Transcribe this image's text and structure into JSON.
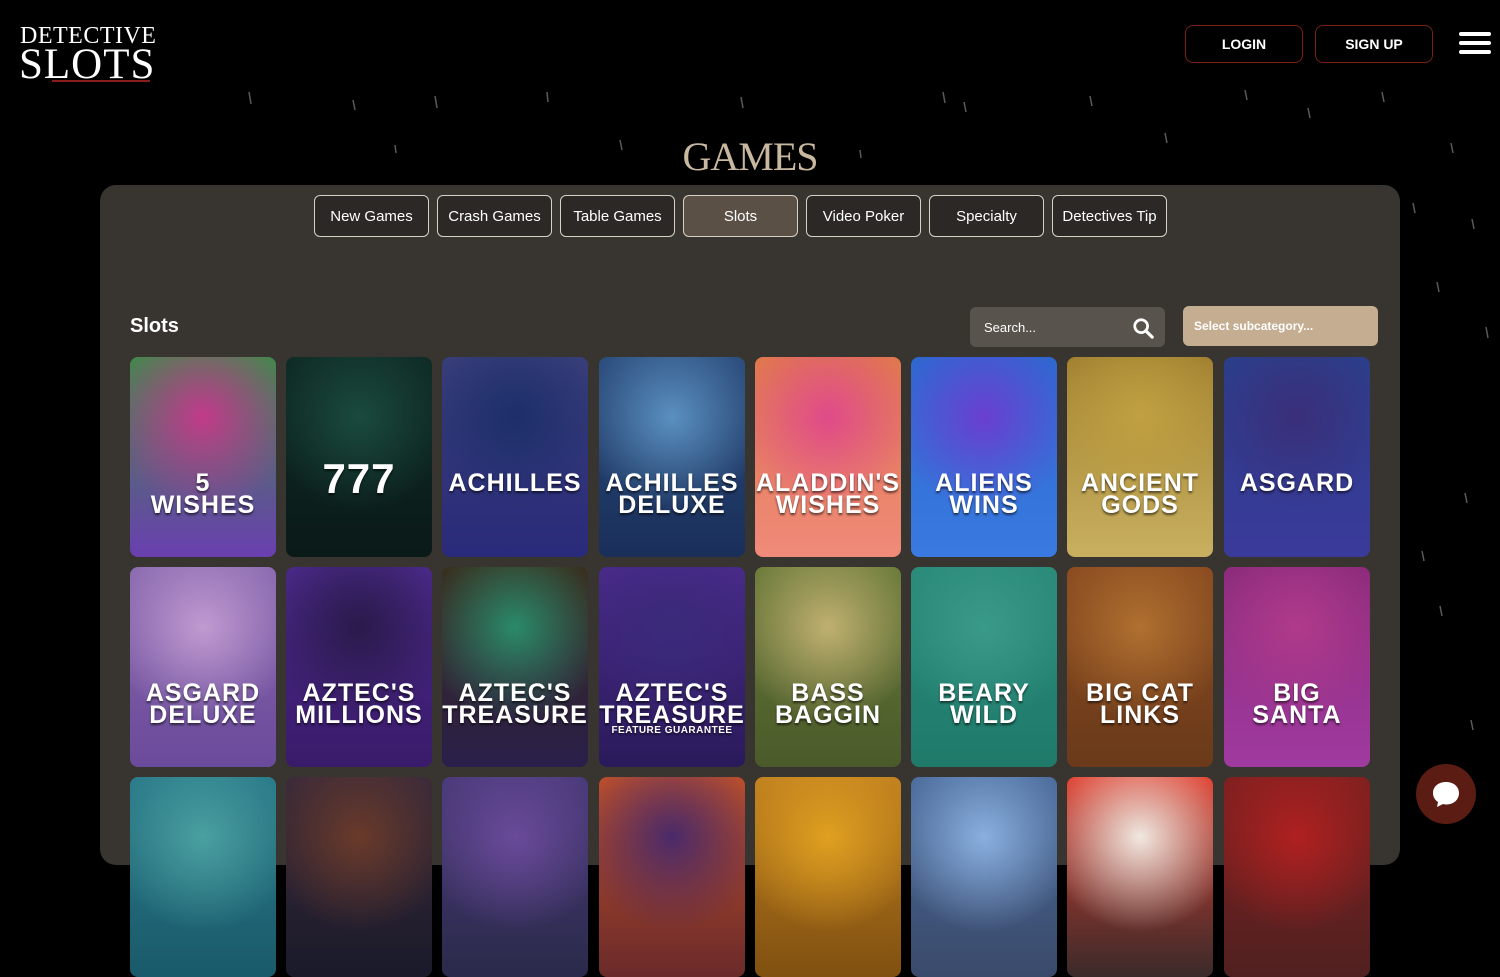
{
  "brand": {
    "line1": "DETECTIVE",
    "line2": "SLOTS",
    "accent": "#8a1c1c"
  },
  "header": {
    "login_label": "LOGIN",
    "signup_label": "SIGN UP",
    "menu_icon": "hamburger-icon"
  },
  "page": {
    "title": "GAMES"
  },
  "tabs": [
    {
      "label": "New Games",
      "active": false
    },
    {
      "label": "Crash Games",
      "active": false
    },
    {
      "label": "Table Games",
      "active": false
    },
    {
      "label": "Slots",
      "active": true
    },
    {
      "label": "Video Poker",
      "active": false
    },
    {
      "label": "Specialty",
      "active": false
    },
    {
      "label": "Detectives Tip",
      "active": false
    }
  ],
  "section": {
    "title": "Slots",
    "search_placeholder": "Search...",
    "search_icon": "search-icon",
    "subcategory_label": "Select subcategory..."
  },
  "games": [
    {
      "line1": "5",
      "line2": "WISHES",
      "sub": "",
      "colors": [
        "#c23a8a",
        "#3f8a4a",
        "#6a3fb0"
      ]
    },
    {
      "line1": "777",
      "line2": "",
      "sub": "",
      "colors": [
        "#1a4a3f",
        "#0f2a25",
        "#0a1a18"
      ]
    },
    {
      "line1": "ACHILLES",
      "line2": "",
      "sub": "",
      "colors": [
        "#1c2f6a",
        "#3a3f7a",
        "#2a2a7a"
      ]
    },
    {
      "line1": "ACHILLES",
      "line2": "DELUXE",
      "sub": "",
      "colors": [
        "#5a90c0",
        "#2a4a7a",
        "#1a2f5a"
      ]
    },
    {
      "line1": "ALADDIN'S",
      "line2": "WISHES",
      "sub": "",
      "colors": [
        "#e04a8a",
        "#e07a4a",
        "#f08a7a"
      ]
    },
    {
      "line1": "ALIENS",
      "line2": "WINS",
      "sub": "",
      "colors": [
        "#6a3fd0",
        "#2a6ad0",
        "#3a7ae0"
      ]
    },
    {
      "line1": "ANCIENT",
      "line2": "GODS",
      "sub": "",
      "colors": [
        "#c0a040",
        "#a08030",
        "#c8b060"
      ]
    },
    {
      "line1": "ASGARD",
      "line2": "",
      "sub": "",
      "colors": [
        "#3a2f7a",
        "#2a3f8a",
        "#3a3a9a"
      ]
    },
    {
      "line1": "ASGARD",
      "line2": "DELUXE",
      "sub": "",
      "colors": [
        "#c09ad0",
        "#8a6ab0",
        "#6a4a9a"
      ]
    },
    {
      "line1": "AZTEC'S",
      "line2": "MILLIONS",
      "sub": "",
      "colors": [
        "#2a1a4a",
        "#4a2a8a",
        "#3a1a6a"
      ]
    },
    {
      "line1": "AZTEC'S",
      "line2": "TREASURE",
      "sub": "",
      "colors": [
        "#2a8a6a",
        "#3a2a1a",
        "#2a1f4a"
      ]
    },
    {
      "line1": "AZTEC'S",
      "line2": "TREASURE",
      "sub": "FEATURE GUARANTEE",
      "colors": [
        "#3a2a7a",
        "#4a2a8a",
        "#2a1a5a"
      ]
    },
    {
      "line1": "BASS",
      "line2": "BAGGIN",
      "sub": "",
      "colors": [
        "#c0b070",
        "#6a7a3a",
        "#4a5a2a"
      ]
    },
    {
      "line1": "BEARY",
      "line2": "WILD",
      "sub": "",
      "colors": [
        "#3a9a8a",
        "#2a8a7a",
        "#1f7a6a"
      ]
    },
    {
      "line1": "BIG CAT",
      "line2": "LINKS",
      "sub": "",
      "colors": [
        "#b07030",
        "#8a4a20",
        "#6a3a1a"
      ]
    },
    {
      "line1": "BIG",
      "line2": "SANTA",
      "sub": "",
      "colors": [
        "#b03a8a",
        "#8a2a7a",
        "#a03aa0"
      ]
    },
    {
      "line1": "",
      "line2": "",
      "sub": "",
      "colors": [
        "#4aa0a0",
        "#2a7a8a",
        "#1a5a6a"
      ]
    },
    {
      "line1": "",
      "line2": "",
      "sub": "",
      "colors": [
        "#6a3a2a",
        "#3a2a3a",
        "#1a1a2a"
      ]
    },
    {
      "line1": "",
      "line2": "",
      "sub": "",
      "colors": [
        "#6a4a9a",
        "#4a3a7a",
        "#2a2a4a"
      ]
    },
    {
      "line1": "",
      "line2": "",
      "sub": "",
      "colors": [
        "#4a2a6a",
        "#c0502a",
        "#6a2a2a"
      ]
    },
    {
      "line1": "",
      "line2": "",
      "sub": "",
      "colors": [
        "#e0a020",
        "#c08020",
        "#805010"
      ]
    },
    {
      "line1": "",
      "line2": "",
      "sub": "",
      "colors": [
        "#8ab0e0",
        "#4a6a9a",
        "#3a4a6a"
      ]
    },
    {
      "line1": "",
      "line2": "",
      "sub": "",
      "colors": [
        "#f0e8e0",
        "#e04030",
        "#3a2a2a"
      ]
    },
    {
      "line1": "",
      "line2": "",
      "sub": "",
      "colors": [
        "#b02020",
        "#802020",
        "#502020"
      ]
    }
  ],
  "chat": {
    "icon": "chat-bubble-icon",
    "color": "#5a1c13"
  },
  "colors": {
    "background": "#000000",
    "panel": "#38342f",
    "title": "#c9b8a0",
    "button_border": "#7a2014"
  }
}
